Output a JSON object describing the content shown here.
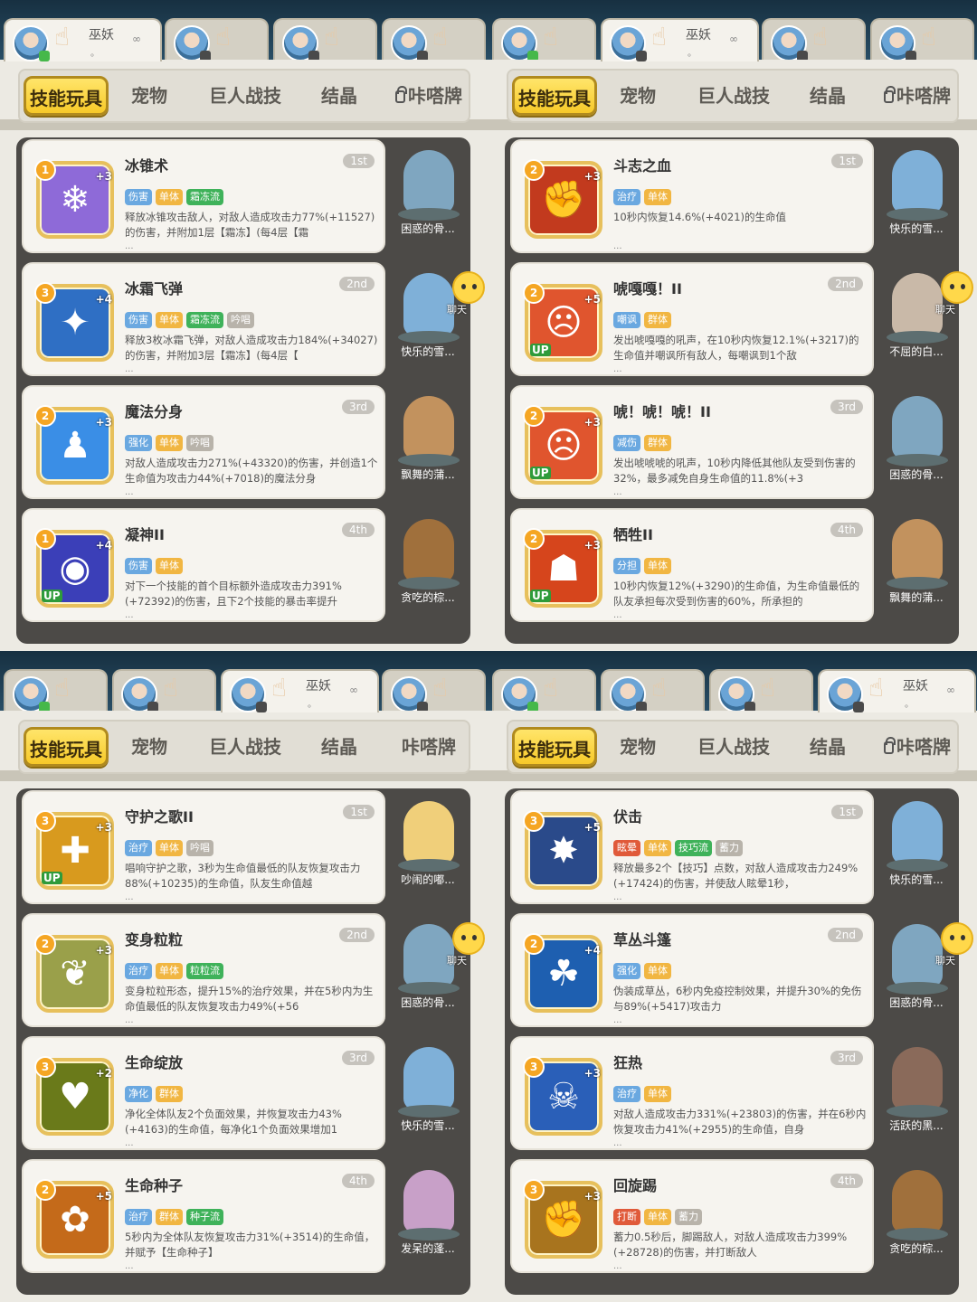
{
  "quadrants": [
    {
      "player_tabs": [
        {
          "avatar": "blue",
          "status": "online"
        },
        {
          "avatar": "red",
          "status": "phone"
        },
        {
          "avatar": "blue",
          "status": "phone"
        },
        {
          "avatar": "dark",
          "status": "phone"
        }
      ],
      "active_player": 0,
      "player_name": "巫妖",
      "player_sub": "。",
      "category_tabs": [
        "技能玩具",
        "宠物",
        "巨人战技",
        "结晶",
        "咔嗒牌"
      ],
      "locked": [
        false,
        false,
        false,
        false,
        true
      ],
      "chat": {
        "row": 1,
        "label": "聊天"
      },
      "skills": [
        {
          "name": "冰锥术",
          "rank": "1st",
          "level": "1",
          "plus": "+3",
          "up": false,
          "color": "#8e6ad8",
          "glyph": "❄",
          "tags": [
            {
              "t": "伤害",
              "c": "#6aa8e0"
            },
            {
              "t": "单体",
              "c": "#f1b642"
            },
            {
              "t": "霜冻流",
              "c": "#3fb25a"
            }
          ],
          "desc": "释放冰锥攻击敌人，对敌人造成攻击力77%(+11527)的伤害，并附加1层【霜冻】(每4层【霜",
          "pet": "困惑的骨...",
          "petc": "#7fa6c0"
        },
        {
          "name": "冰霜飞弹",
          "rank": "2nd",
          "level": "3",
          "plus": "+4",
          "up": false,
          "color": "#2f6fc4",
          "glyph": "✦",
          "tags": [
            {
              "t": "伤害",
              "c": "#6aa8e0"
            },
            {
              "t": "单体",
              "c": "#f1b642"
            },
            {
              "t": "霜冻流",
              "c": "#3fb25a"
            },
            {
              "t": "吟唱",
              "c": "#b8b3aa"
            }
          ],
          "desc": "释放3枚冰霜飞弹，对敌人造成攻击力184%(+34027)的伤害，并附加3层【霜冻】(每4层【",
          "pet": "快乐的雪...",
          "petc": "#7fb0d8"
        },
        {
          "name": "魔法分身",
          "rank": "3rd",
          "level": "2",
          "plus": "+3",
          "up": false,
          "color": "#3a8ee6",
          "glyph": "♟",
          "tags": [
            {
              "t": "强化",
              "c": "#6aa8e0"
            },
            {
              "t": "单体",
              "c": "#f1b642"
            },
            {
              "t": "吟唱",
              "c": "#b8b3aa"
            }
          ],
          "desc": "对敌人造成攻击力271%(+43320)的伤害，并创造1个生命值为攻击力44%(+7018)的魔法分身",
          "pet": "飘舞的蒲...",
          "petc": "#c2925e"
        },
        {
          "name": "凝神II",
          "rank": "4th",
          "level": "1",
          "plus": "+4",
          "up": true,
          "color": "#3b3fb8",
          "glyph": "◉",
          "tags": [
            {
              "t": "伤害",
              "c": "#6aa8e0"
            },
            {
              "t": "单体",
              "c": "#f1b642"
            }
          ],
          "desc": "对下一个技能的首个目标额外造成攻击力391%(+72392)的伤害，且下2个技能的暴击率提升",
          "pet": "贪吃的棕...",
          "petc": "#a0703c"
        }
      ]
    },
    {
      "player_tabs": [
        {
          "avatar": "blue",
          "status": "online"
        },
        {
          "avatar": "red",
          "status": "phone"
        },
        {
          "avatar": "blue",
          "status": "phone"
        },
        {
          "avatar": "dark",
          "status": "phone"
        }
      ],
      "active_player": 1,
      "player_name": "巫妖",
      "player_sub": "。",
      "category_tabs": [
        "技能玩具",
        "宠物",
        "巨人战技",
        "结晶",
        "咔嗒牌"
      ],
      "locked": [
        false,
        false,
        false,
        false,
        true
      ],
      "chat": {
        "row": 1,
        "label": "聊天"
      },
      "skills": [
        {
          "name": "斗志之血",
          "rank": "1st",
          "level": "2",
          "plus": "+3",
          "up": false,
          "color": "#c23a1e",
          "glyph": "✊",
          "tags": [
            {
              "t": "治疗",
              "c": "#6aa8e0"
            },
            {
              "t": "单体",
              "c": "#f1b642"
            }
          ],
          "desc": "10秒内恢复14.6%(+4021)的生命值",
          "pet": "快乐的雪...",
          "petc": "#7fb0d8"
        },
        {
          "name": "唬嘎嘎！II",
          "rank": "2nd",
          "level": "2",
          "plus": "+5",
          "up": true,
          "color": "#e0552e",
          "glyph": "☹",
          "tags": [
            {
              "t": "嘲讽",
              "c": "#6aa8e0"
            },
            {
              "t": "群体",
              "c": "#f1b642"
            }
          ],
          "desc": "发出唬嘎嘎的吼声，在10秒内恢复12.1%(+3217)的生命值并嘲讽所有敌人，每嘲讽到1个敌",
          "pet": "不屈的白...",
          "petc": "#c9b9a8"
        },
        {
          "name": "唬！唬！唬！II",
          "rank": "3rd",
          "level": "2",
          "plus": "+3",
          "up": true,
          "color": "#e0552e",
          "glyph": "☹",
          "tags": [
            {
              "t": "减伤",
              "c": "#6aa8e0"
            },
            {
              "t": "群体",
              "c": "#f1b642"
            }
          ],
          "desc": "发出唬唬唬的吼声，10秒内降低其他队友受到伤害的32%，最多减免自身生命值的11.8%(+3",
          "pet": "困惑的骨...",
          "petc": "#7fa6c0"
        },
        {
          "name": "牺牲II",
          "rank": "4th",
          "level": "2",
          "plus": "+3",
          "up": true,
          "color": "#d6451c",
          "glyph": "☗",
          "tags": [
            {
              "t": "分担",
              "c": "#6aa8e0"
            },
            {
              "t": "单体",
              "c": "#f1b642"
            }
          ],
          "desc": "10秒内恢复12%(+3290)的生命值，为生命值最低的队友承担每次受到伤害的60%，所承担的",
          "pet": "飘舞的蒲...",
          "petc": "#c2925e"
        }
      ]
    },
    {
      "player_tabs": [
        {
          "avatar": "blue",
          "status": "online"
        },
        {
          "avatar": "red",
          "status": "phone"
        },
        {
          "avatar": "blue",
          "status": "phone"
        },
        {
          "avatar": "dark",
          "status": "phone"
        }
      ],
      "active_player": 2,
      "player_name": "巫妖",
      "player_sub": "。",
      "category_tabs": [
        "技能玩具",
        "宠物",
        "巨人战技",
        "结晶",
        "咔嗒牌"
      ],
      "locked": [
        false,
        false,
        false,
        false,
        false
      ],
      "chat": {
        "row": 1,
        "label": "聊天"
      },
      "skills": [
        {
          "name": "守护之歌II",
          "rank": "1st",
          "level": "3",
          "plus": "+3",
          "up": true,
          "color": "#d89a1e",
          "glyph": "✚",
          "tags": [
            {
              "t": "治疗",
              "c": "#6aa8e0"
            },
            {
              "t": "单体",
              "c": "#f1b642"
            },
            {
              "t": "吟唱",
              "c": "#b8b3aa"
            }
          ],
          "desc": "唱响守护之歌，3秒为生命值最低的队友恢复攻击力88%(+10235)的生命值，队友生命值越",
          "pet": "吵闹的嘟...",
          "petc": "#f0cf7a"
        },
        {
          "name": "变身粒粒",
          "rank": "2nd",
          "level": "2",
          "plus": "+3",
          "up": false,
          "color": "#9aa04a",
          "glyph": "❦",
          "tags": [
            {
              "t": "治疗",
              "c": "#6aa8e0"
            },
            {
              "t": "单体",
              "c": "#f1b642"
            },
            {
              "t": "粒粒流",
              "c": "#3fb25a"
            }
          ],
          "desc": "变身粒粒形态，提升15%的治疗效果，并在5秒内为生命值最低的队友恢复攻击力49%(+56",
          "pet": "困惑的骨...",
          "petc": "#7fa6c0"
        },
        {
          "name": "生命绽放",
          "rank": "3rd",
          "level": "3",
          "plus": "+2",
          "up": false,
          "color": "#6a7a1a",
          "glyph": "♥",
          "tags": [
            {
              "t": "净化",
              "c": "#6aa8e0"
            },
            {
              "t": "群体",
              "c": "#f1b642"
            }
          ],
          "desc": "净化全体队友2个负面效果，并恢复攻击力43%(+4163)的生命值，每净化1个负面效果增加1",
          "pet": "快乐的雪...",
          "petc": "#7fb0d8"
        },
        {
          "name": "生命种子",
          "rank": "4th",
          "level": "2",
          "plus": "+5",
          "up": false,
          "color": "#c46a1a",
          "glyph": "✿",
          "tags": [
            {
              "t": "治疗",
              "c": "#6aa8e0"
            },
            {
              "t": "群体",
              "c": "#f1b642"
            },
            {
              "t": "种子流",
              "c": "#3fb25a"
            }
          ],
          "desc": "5秒内为全体队友恢复攻击力31%(+3514)的生命值，并赋予【生命种子】",
          "pet": "发呆的蓬...",
          "petc": "#c8a0c8"
        }
      ]
    },
    {
      "player_tabs": [
        {
          "avatar": "blue",
          "status": "online"
        },
        {
          "avatar": "red",
          "status": "phone"
        },
        {
          "avatar": "blue",
          "status": "phone"
        },
        {
          "avatar": "dark",
          "status": "phone"
        }
      ],
      "active_player": 3,
      "player_name": "巫妖",
      "player_sub": "。",
      "category_tabs": [
        "技能玩具",
        "宠物",
        "巨人战技",
        "结晶",
        "咔嗒牌"
      ],
      "locked": [
        false,
        false,
        false,
        false,
        true
      ],
      "chat": {
        "row": 1,
        "label": "聊天"
      },
      "skills": [
        {
          "name": "伏击",
          "rank": "1st",
          "level": "3",
          "plus": "+5",
          "up": false,
          "color": "#2a4a8a",
          "glyph": "✸",
          "tags": [
            {
              "t": "眩晕",
              "c": "#e05a3a"
            },
            {
              "t": "单体",
              "c": "#f1b642"
            },
            {
              "t": "技巧流",
              "c": "#3fb25a"
            },
            {
              "t": "蓄力",
              "c": "#b8b3aa"
            }
          ],
          "desc": "释放最多2个【技巧】点数，对敌人造成攻击力249%(+17424)的伤害，并使敌人眩晕1秒，",
          "pet": "快乐的雪...",
          "petc": "#7fb0d8"
        },
        {
          "name": "草丛斗篷",
          "rank": "2nd",
          "level": "2",
          "plus": "+4",
          "up": false,
          "color": "#1e5fb0",
          "glyph": "☘",
          "tags": [
            {
              "t": "强化",
              "c": "#6aa8e0"
            },
            {
              "t": "单体",
              "c": "#f1b642"
            }
          ],
          "desc": "伪装成草丛，6秒内免疫控制效果，并提升30%的免伤与89%(+5417)攻击力",
          "pet": "困惑的骨...",
          "petc": "#7fa6c0"
        },
        {
          "name": "狂热",
          "rank": "3rd",
          "level": "3",
          "plus": "+3",
          "up": false,
          "color": "#2a5fb8",
          "glyph": "☠",
          "tags": [
            {
              "t": "治疗",
              "c": "#6aa8e0"
            },
            {
              "t": "单体",
              "c": "#f1b642"
            }
          ],
          "desc": "对敌人造成攻击力331%(+23803)的伤害，并在6秒内恢复攻击力41%(+2955)的生命值，自身",
          "pet": "活跃的黑...",
          "petc": "#8a6a5a"
        },
        {
          "name": "回旋踢",
          "rank": "4th",
          "level": "3",
          "plus": "+3",
          "up": false,
          "color": "#a8741e",
          "glyph": "✊",
          "tags": [
            {
              "t": "打断",
              "c": "#e05a3a"
            },
            {
              "t": "单体",
              "c": "#f1b642"
            },
            {
              "t": "蓄力",
              "c": "#b8b3aa"
            }
          ],
          "desc": "蓄力0.5秒后，脚踢敌人，对敌人造成攻击力399%(+28728)的伤害，并打断敌人",
          "pet": "贪吃的棕...",
          "petc": "#a0703c"
        }
      ]
    }
  ]
}
